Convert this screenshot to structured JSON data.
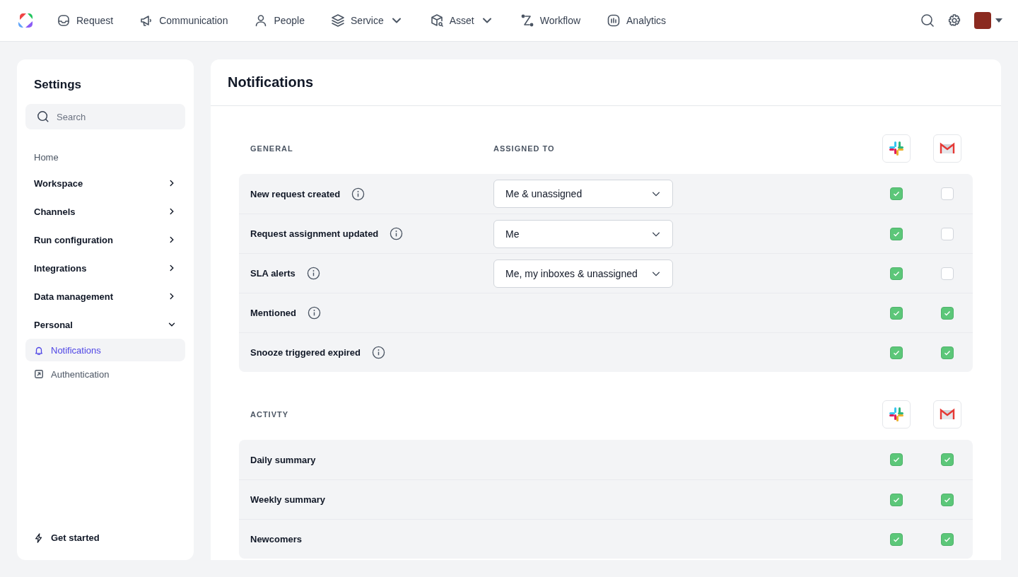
{
  "nav": [
    {
      "label": "Request",
      "dropdown": false
    },
    {
      "label": "Communication",
      "dropdown": false
    },
    {
      "label": "People",
      "dropdown": false
    },
    {
      "label": "Service",
      "dropdown": true
    },
    {
      "label": "Asset",
      "dropdown": true
    },
    {
      "label": "Workflow",
      "dropdown": false
    },
    {
      "label": "Analytics",
      "dropdown": false
    }
  ],
  "sidebar": {
    "title": "Settings",
    "search": {
      "placeholder": "Search"
    },
    "items": [
      {
        "label": "Home",
        "kind": "link",
        "selected": false
      },
      {
        "label": "Workspace",
        "kind": "group",
        "expanded": false
      },
      {
        "label": "Channels",
        "kind": "group",
        "expanded": false
      },
      {
        "label": "Run configuration",
        "kind": "group",
        "expanded": false
      },
      {
        "label": "Integrations",
        "kind": "group",
        "expanded": false
      },
      {
        "label": "Data management",
        "kind": "group",
        "expanded": false
      },
      {
        "label": "Personal",
        "kind": "group",
        "expanded": true
      },
      {
        "label": "Notifications",
        "kind": "sub",
        "selected": true
      },
      {
        "label": "Authentication",
        "kind": "sub",
        "selected": false
      }
    ],
    "footer": "Get started"
  },
  "page": {
    "title": "Notifications",
    "sections": [
      {
        "heading": "GENERAL",
        "column_heading": "ASSIGNED TO",
        "rows": [
          {
            "label": "New request created",
            "info": true,
            "assigned": "Me & unassigned",
            "checks": [
              true,
              false
            ]
          },
          {
            "label": "Request assignment updated",
            "info": true,
            "assigned": "Me",
            "checks": [
              true,
              false
            ]
          },
          {
            "label": "SLA alerts",
            "info": true,
            "assigned": "Me, my inboxes & unassigned",
            "checks": [
              true,
              false
            ]
          },
          {
            "label": "Mentioned",
            "info": true,
            "checks": [
              true,
              true
            ]
          },
          {
            "label": "Snooze triggered expired",
            "info": true,
            "checks": [
              true,
              true
            ]
          }
        ]
      },
      {
        "heading": "ACTIVTY",
        "rows": [
          {
            "label": "Daily summary",
            "info": false,
            "checks": [
              true,
              true
            ]
          },
          {
            "label": "Weekly summary",
            "info": false,
            "checks": [
              true,
              true
            ]
          },
          {
            "label": "Newcomers",
            "info": false,
            "checks": [
              true,
              true
            ]
          }
        ]
      }
    ]
  }
}
